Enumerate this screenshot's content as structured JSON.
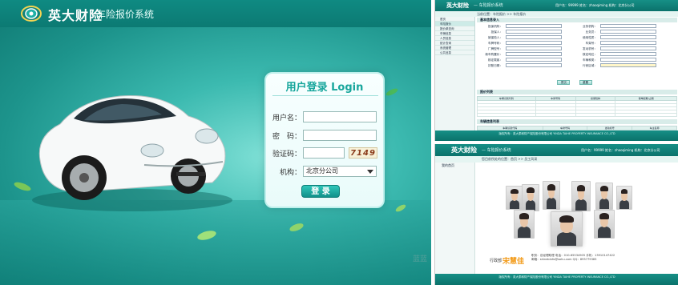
{
  "login": {
    "brand": "英大财险",
    "system": "车险报价系统",
    "panel_title": "用户登录 Login",
    "username_label": "用户名：",
    "password_label": "密　码：",
    "captcha_label": "验证码：",
    "captcha_text": "7149",
    "org_label": "机构：",
    "org_selected": "北京分公司",
    "login_button": "登  录",
    "watermark": "蓝蓝",
    "accent": "#17a69c"
  },
  "quote_page": {
    "brand": "英大财险",
    "system": "— 车险报价系统",
    "header_links": "用户名：99999    姓名：zhaoqiming    机构：北京分公司",
    "breadcrumb": "当前位置：车险报价 >> 车险报价",
    "nav": [
      "首页",
      "车险报价",
      "报价单查询",
      "车辆信息",
      "人员信息",
      "统计查询",
      "系统管理",
      "公共信息"
    ],
    "section_title": "基本信息录入",
    "form_labels": [
      "投保机构：",
      "投保人：",
      "被保险人：",
      "车牌号码：",
      "厂牌型号：",
      "新车购置价：",
      "核定载客：",
      "初登日期："
    ],
    "form_labels_right": [
      "业务机构：",
      "业务员：",
      "使用性质：",
      "车架号：",
      "发动机号：",
      "核定吨位：",
      "车辆种类：",
      "行驶区域："
    ],
    "buttons": [
      "提交",
      "重置"
    ],
    "table_title": "报价列表",
    "table_headers": [
      "车辆识别代码",
      "车牌号码",
      "投保险种",
      "保单起期/止期"
    ],
    "table2_title": "车辆信息列表",
    "table2_headers": [
      "车辆识别代码",
      "车牌号码",
      "发动机号",
      "车主名称"
    ],
    "footer": "版权所有：英大泰和财产保险股份有限公司    YINDA TAIHE PROPERTY INSURANCE CO.,LTD"
  },
  "team_page": {
    "brand": "英大财险",
    "system": "— 车险报价系统",
    "header_links": "用户名：99999    姓名：zhaoqiming    机构：北京分公司",
    "nav": [
      "我的首页"
    ],
    "breadcrumb": "您目前所处的位置：首页 >> 员工风采",
    "dept": "行政部",
    "name": "宋慧佳",
    "info": "职务：总经理助理    电话：010-65534905    手机：13910147422",
    "email": "邮箱：shinebinfo@sohu.com    QQ：895779383",
    "footer": "版权所有：英大泰和财产保险股份有限公司    YINDA TAIHE PROPERTY INSURANCE CO.,LTD"
  }
}
